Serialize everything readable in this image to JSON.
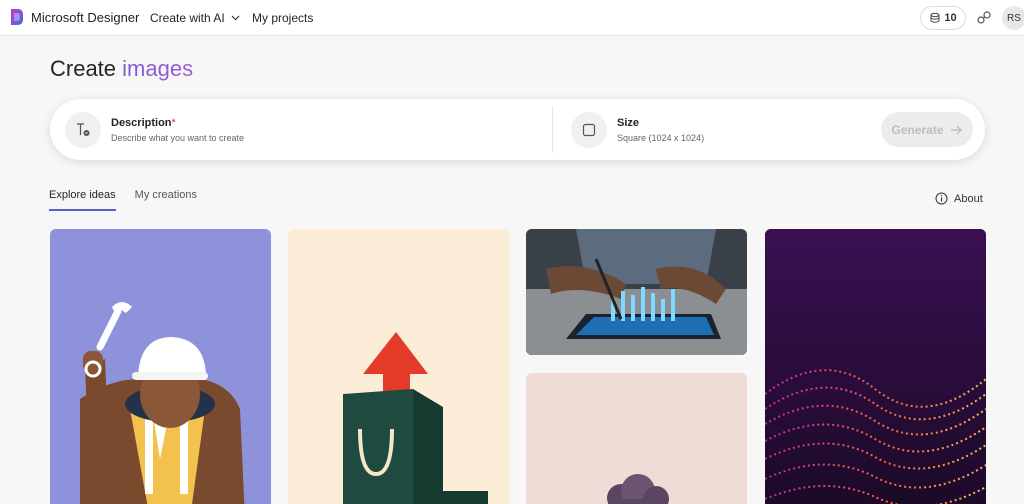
{
  "header": {
    "brand": "Microsoft Designer",
    "nav": {
      "create_label": "Create with AI",
      "projects_label": "My projects"
    },
    "credits": "10",
    "avatar_initials": "RS"
  },
  "page": {
    "title_prefix": "Create",
    "title_accent": "images"
  },
  "prompt": {
    "description": {
      "title": "Description",
      "required_mark": "*",
      "placeholder": "Describe what you want to create"
    },
    "size": {
      "title": "Size",
      "value": "Square (1024 x 1024)"
    },
    "generate_label": "Generate"
  },
  "tabs": [
    {
      "label": "Explore ideas",
      "active": true
    },
    {
      "label": "My creations",
      "active": false
    }
  ],
  "about_label": "About",
  "colors": {
    "accent": "#7b5cd6",
    "tab_underline": "#5b5fc7"
  },
  "icons": [
    "designer-logo-icon",
    "chevron-down-icon",
    "coin-stack-icon",
    "share-link-icon",
    "text-input-icon",
    "square-size-icon",
    "arrow-right-icon",
    "info-icon"
  ],
  "cards": [
    {
      "subject": "construction-worker-illustration"
    },
    {
      "subject": "shopping-bag-arrow-illustration"
    },
    {
      "subject": "tablet-hologram-photo"
    },
    {
      "subject": "pink-cloud-illustration"
    },
    {
      "subject": "purple-particle-wave"
    }
  ]
}
